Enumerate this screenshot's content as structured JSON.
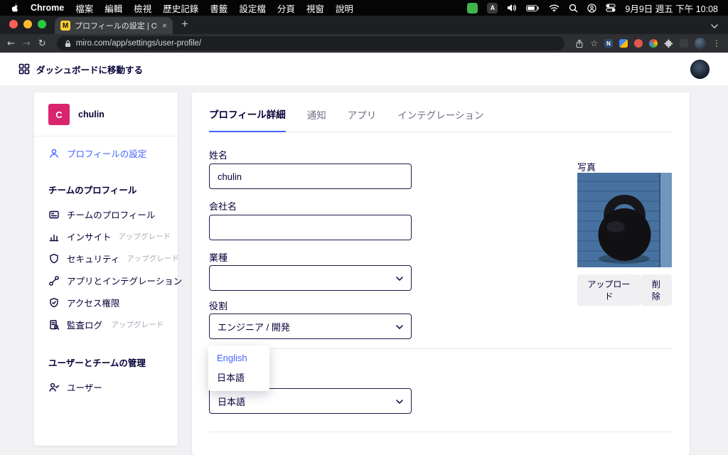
{
  "menubar": {
    "app_name": "Chrome",
    "menus": [
      "檔案",
      "編輯",
      "檢視",
      "歷史記錄",
      "書籤",
      "設定檔",
      "分頁",
      "視窗",
      "說明"
    ],
    "status_icon_letter": "A",
    "clock": "9月9日 週五 下午 10:08"
  },
  "browser": {
    "tab_title": "プロフィールの設定 | Online Wh",
    "favicon_letter": "M",
    "url": "miro.com/app/settings/user-profile/",
    "extension_letter": "N"
  },
  "header": {
    "dashboard_link": "ダッシュボードに移動する"
  },
  "sidebar": {
    "avatar_letter": "C",
    "username": "chulin",
    "active_item": "プロフィールの設定",
    "team_heading": "チームのプロフィール",
    "items": [
      {
        "label": "チームのプロフィール",
        "badge": ""
      },
      {
        "label": "インサイト",
        "badge": "アップグレード"
      },
      {
        "label": "セキュリティ",
        "badge": "アップグレード"
      },
      {
        "label": "アプリとインテグレーション",
        "badge": ""
      },
      {
        "label": "アクセス権限",
        "badge": ""
      },
      {
        "label": "監査ログ",
        "badge": "アップグレード"
      }
    ],
    "admin_heading": "ユーザーとチームの管理",
    "admin_item": "ユーザー"
  },
  "main": {
    "tabs": [
      {
        "label": "プロフィール詳細"
      },
      {
        "label": "通知"
      },
      {
        "label": "アプリ"
      },
      {
        "label": "インテグレーション"
      }
    ],
    "form": {
      "name_label": "姓名",
      "name_value": "chulin",
      "company_label": "会社名",
      "company_value": "",
      "industry_label": "業種",
      "industry_value": "",
      "role_label": "役割",
      "role_value": "エンジニア / 開発",
      "language_value": "日本語"
    },
    "language_dropdown": {
      "options": [
        {
          "label": "English"
        },
        {
          "label": "日本語"
        }
      ]
    },
    "photo": {
      "label": "写真",
      "upload": "アップロード",
      "remove": "削除"
    }
  },
  "colors": {
    "accent_blue": "#4262ff",
    "avatar_pink": "#d9246e",
    "text_dark": "#050038",
    "miro_yellow": "#ffd02f"
  }
}
